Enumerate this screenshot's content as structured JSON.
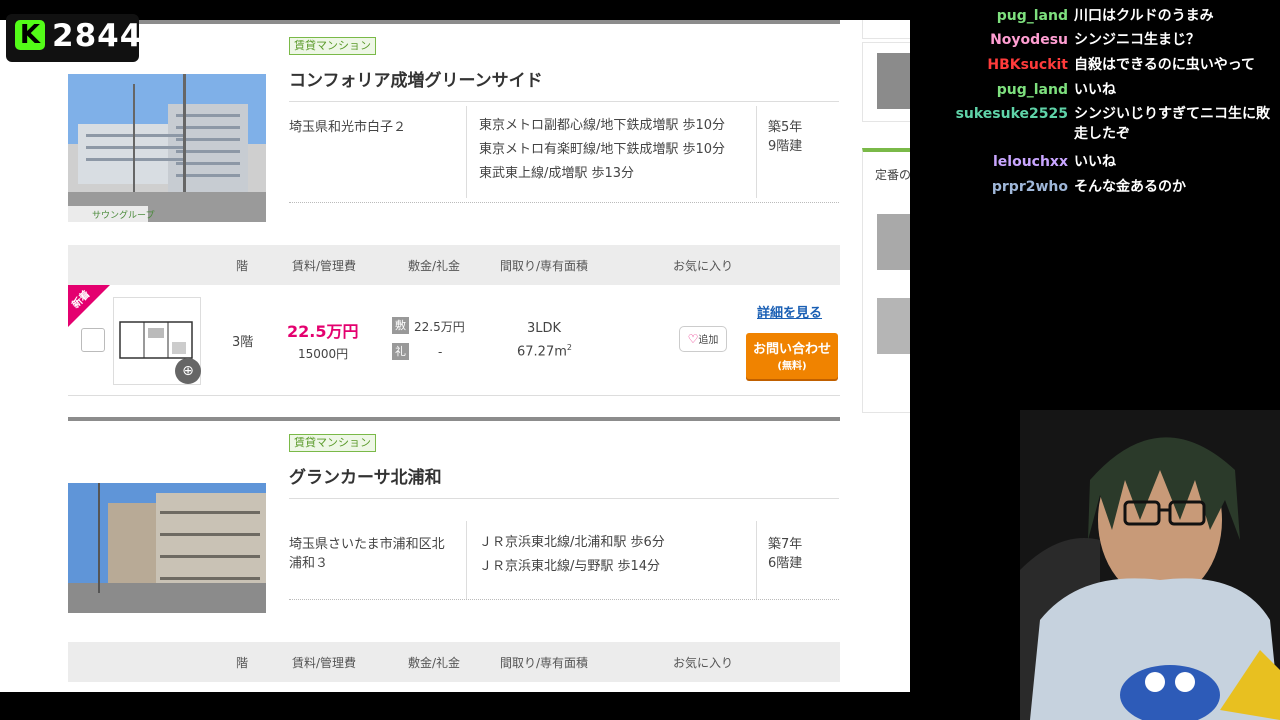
{
  "stream": {
    "viewer_count": "2844",
    "logo_letter": "K",
    "brand_color": "#53fc18"
  },
  "listings": [
    {
      "type_tag": "賃貸マンション",
      "name": "コンフォリア成増グリーンサイド",
      "address": "埼玉県和光市白子２",
      "stations": [
        "東京メトロ副都心線/地下鉄成増駅 歩10分",
        "東京メトロ有楽町線/地下鉄成増駅 歩10分",
        "東武東上線/成増駅 歩13分"
      ],
      "age": "築5年",
      "floors": "9階建",
      "photo_caption": "サウングループ",
      "table_headers": {
        "floor": "階",
        "rent": "賃料/管理費",
        "deposit": "敷金/礼金",
        "layout": "間取り/専有面積",
        "favorite": "お気に入り"
      },
      "unit": {
        "new_badge": "新着",
        "floor": "3階",
        "rent": "22.5万円",
        "management_fee": "15000円",
        "deposit_icon": "敷",
        "deposit": "22.5万円",
        "key_money_icon": "礼",
        "key_money": "-",
        "layout": "3LDK",
        "area": "67.27m",
        "area_unit_sup": "2",
        "favorite_label": "追加",
        "detail_link": "詳細を見る",
        "inquiry_label": "お問い合わせ",
        "inquiry_sub": "(無料)"
      }
    },
    {
      "type_tag": "賃貸マンション",
      "name": "グランカーサ北浦和",
      "address": "埼玉県さいたま市浦和区北浦和３",
      "stations": [
        "ＪＲ京浜東北線/北浦和駅 歩6分",
        "ＪＲ京浜東北線/与野駅 歩14分"
      ],
      "age": "築7年",
      "floors": "6階建",
      "table_headers": {
        "floor": "階",
        "rent": "賃料/管理費",
        "deposit": "敷金/礼金",
        "layout": "間取り/専有面積",
        "favorite": "お気に入り"
      }
    }
  ],
  "sidebar": {
    "section_label": "定番の"
  },
  "chat": [
    {
      "user": "pug_land",
      "color": "#7ee07e",
      "message": "川口はクルドのうまみ"
    },
    {
      "user": "Noyodesu",
      "color": "#ff9ed2",
      "message": "シンジニコ生まじ？"
    },
    {
      "user": "HBKsuckit",
      "color": "#ff3b3b",
      "message": "自殺はできるのに虫いやって"
    },
    {
      "user": "pug_land",
      "color": "#7ee07e",
      "message": "いいね"
    },
    {
      "user": "sukesuke2525",
      "color": "#5fd3a8",
      "message": "シンジいじりすぎてニコ生に敗走したぞ"
    },
    {
      "user": "lelouchxx",
      "color": "#c9a6ff",
      "message": "いいね"
    },
    {
      "user": "prpr2who",
      "color": "#9fb7d9",
      "message": "そんな金あるのか"
    }
  ]
}
